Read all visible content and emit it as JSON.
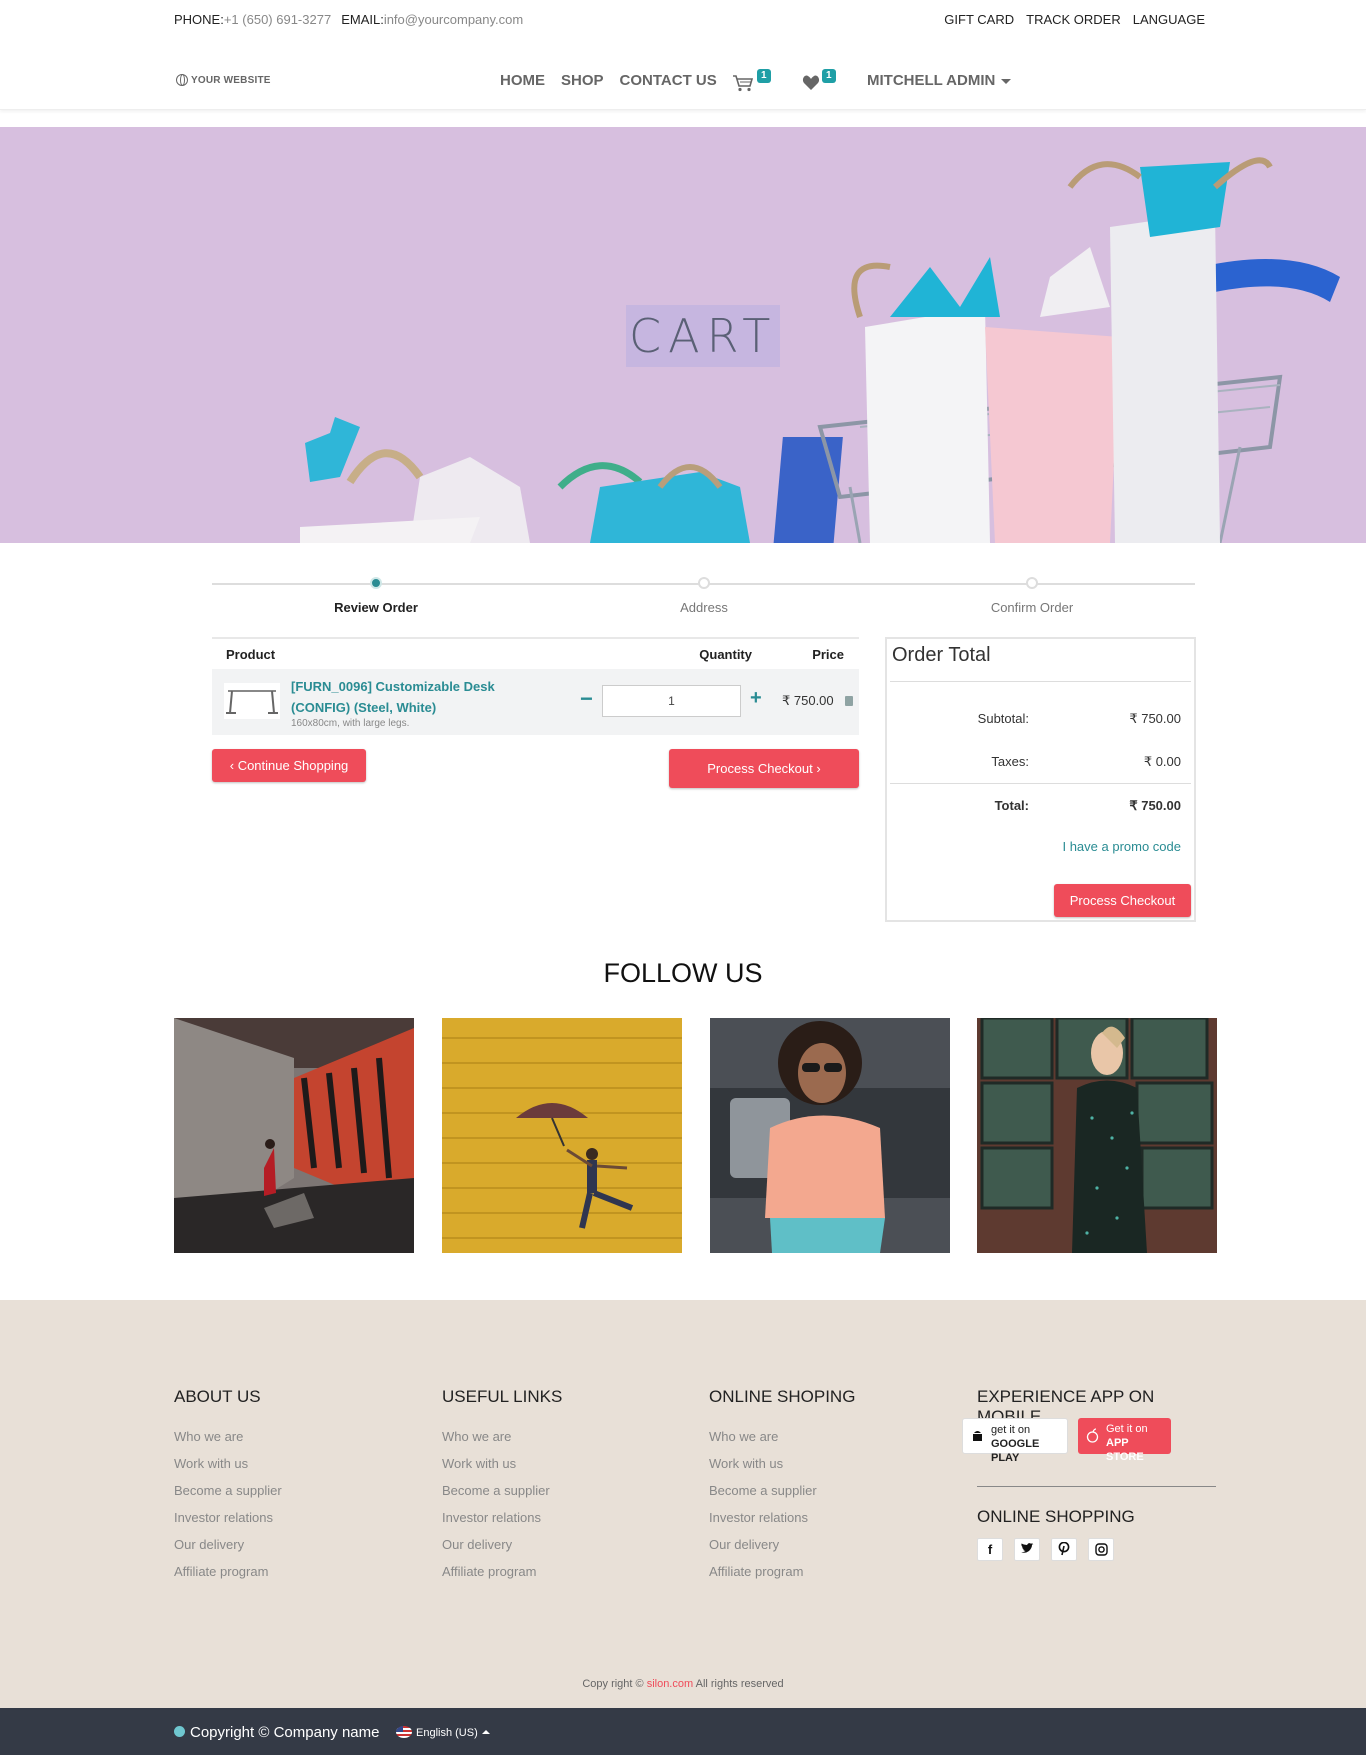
{
  "topbar": {
    "phone_label": "PHONE:",
    "phone_value": "+1 (650) 691-3277",
    "email_label": "EMAIL:",
    "email_value": "info@yourcompany.com",
    "links": [
      "GIFT CARD",
      "TRACK ORDER",
      "LANGUAGE"
    ]
  },
  "nav": {
    "logo_text": "YOUR WEBSITE",
    "menu": [
      "HOME",
      "SHOP",
      "CONTACT US"
    ],
    "cart_count": "1",
    "wishlist_count": "1",
    "user": "MITCHELL ADMIN"
  },
  "hero": {
    "title": "CART"
  },
  "steps": [
    {
      "label": "Review Order",
      "active": true
    },
    {
      "label": "Address",
      "active": false
    },
    {
      "label": "Confirm Order",
      "active": false
    }
  ],
  "cart": {
    "headers": {
      "product": "Product",
      "quantity": "Quantity",
      "price": "Price"
    },
    "items": [
      {
        "name": "[FURN_0096] Customizable Desk (CONFIG) (Steel, White)",
        "description": "160x80cm, with large legs.",
        "quantity": "1",
        "price": "₹ 750.00"
      }
    ],
    "continue_label": "Continue Shopping",
    "checkout_label": "Process Checkout"
  },
  "order_total": {
    "title": "Order Total",
    "subtotal_label": "Subtotal:",
    "subtotal_value": "₹ 750.00",
    "taxes_label": "Taxes:",
    "taxes_value": "₹ 0.00",
    "total_label": "Total:",
    "total_value": "₹ 750.00",
    "promo_label": "I have a promo code",
    "checkout_label": "Process Checkout"
  },
  "follow": {
    "title": "FOLLOW US"
  },
  "footer": {
    "columns": [
      {
        "title": "ABOUT US",
        "links": [
          "Who we are",
          "Work with us",
          "Become a supplier",
          "Investor relations",
          "Our delivery",
          "Affiliate program"
        ]
      },
      {
        "title": "USEFUL LINKS",
        "links": [
          "Who we are",
          "Work with us",
          "Become a supplier",
          "Investor relations",
          "Our delivery",
          "Affiliate program"
        ]
      },
      {
        "title": "ONLINE SHOPING",
        "links": [
          "Who we are",
          "Work with us",
          "Become a supplier",
          "Investor relations",
          "Our delivery",
          "Affiliate program"
        ]
      }
    ],
    "app_title": "EXPERIENCE APP ON MOBILE",
    "google_play_line1": "get it on",
    "google_play_line2": "GOOGLE PLAY",
    "app_store_line1": "Get it on",
    "app_store_line2": "APP STORE",
    "online_title": "ONLINE SHOPPING",
    "social_icons": [
      "facebook-icon",
      "twitter-icon",
      "pinterest-icon",
      "instagram-icon"
    ],
    "copy_prefix": "Copy right ©",
    "copy_brand": "silon.com",
    "copy_suffix": "All rights reserved"
  },
  "bottombar": {
    "copyright": "Copyright © Company name",
    "language": "English (US)"
  },
  "colors": {
    "accent": "#1f9fa6",
    "primary_button": "#ef4c5a",
    "footer_bg": "#e8e0d7",
    "bottombar_bg": "#343a46",
    "hero_bg": "#d7bfdf"
  }
}
